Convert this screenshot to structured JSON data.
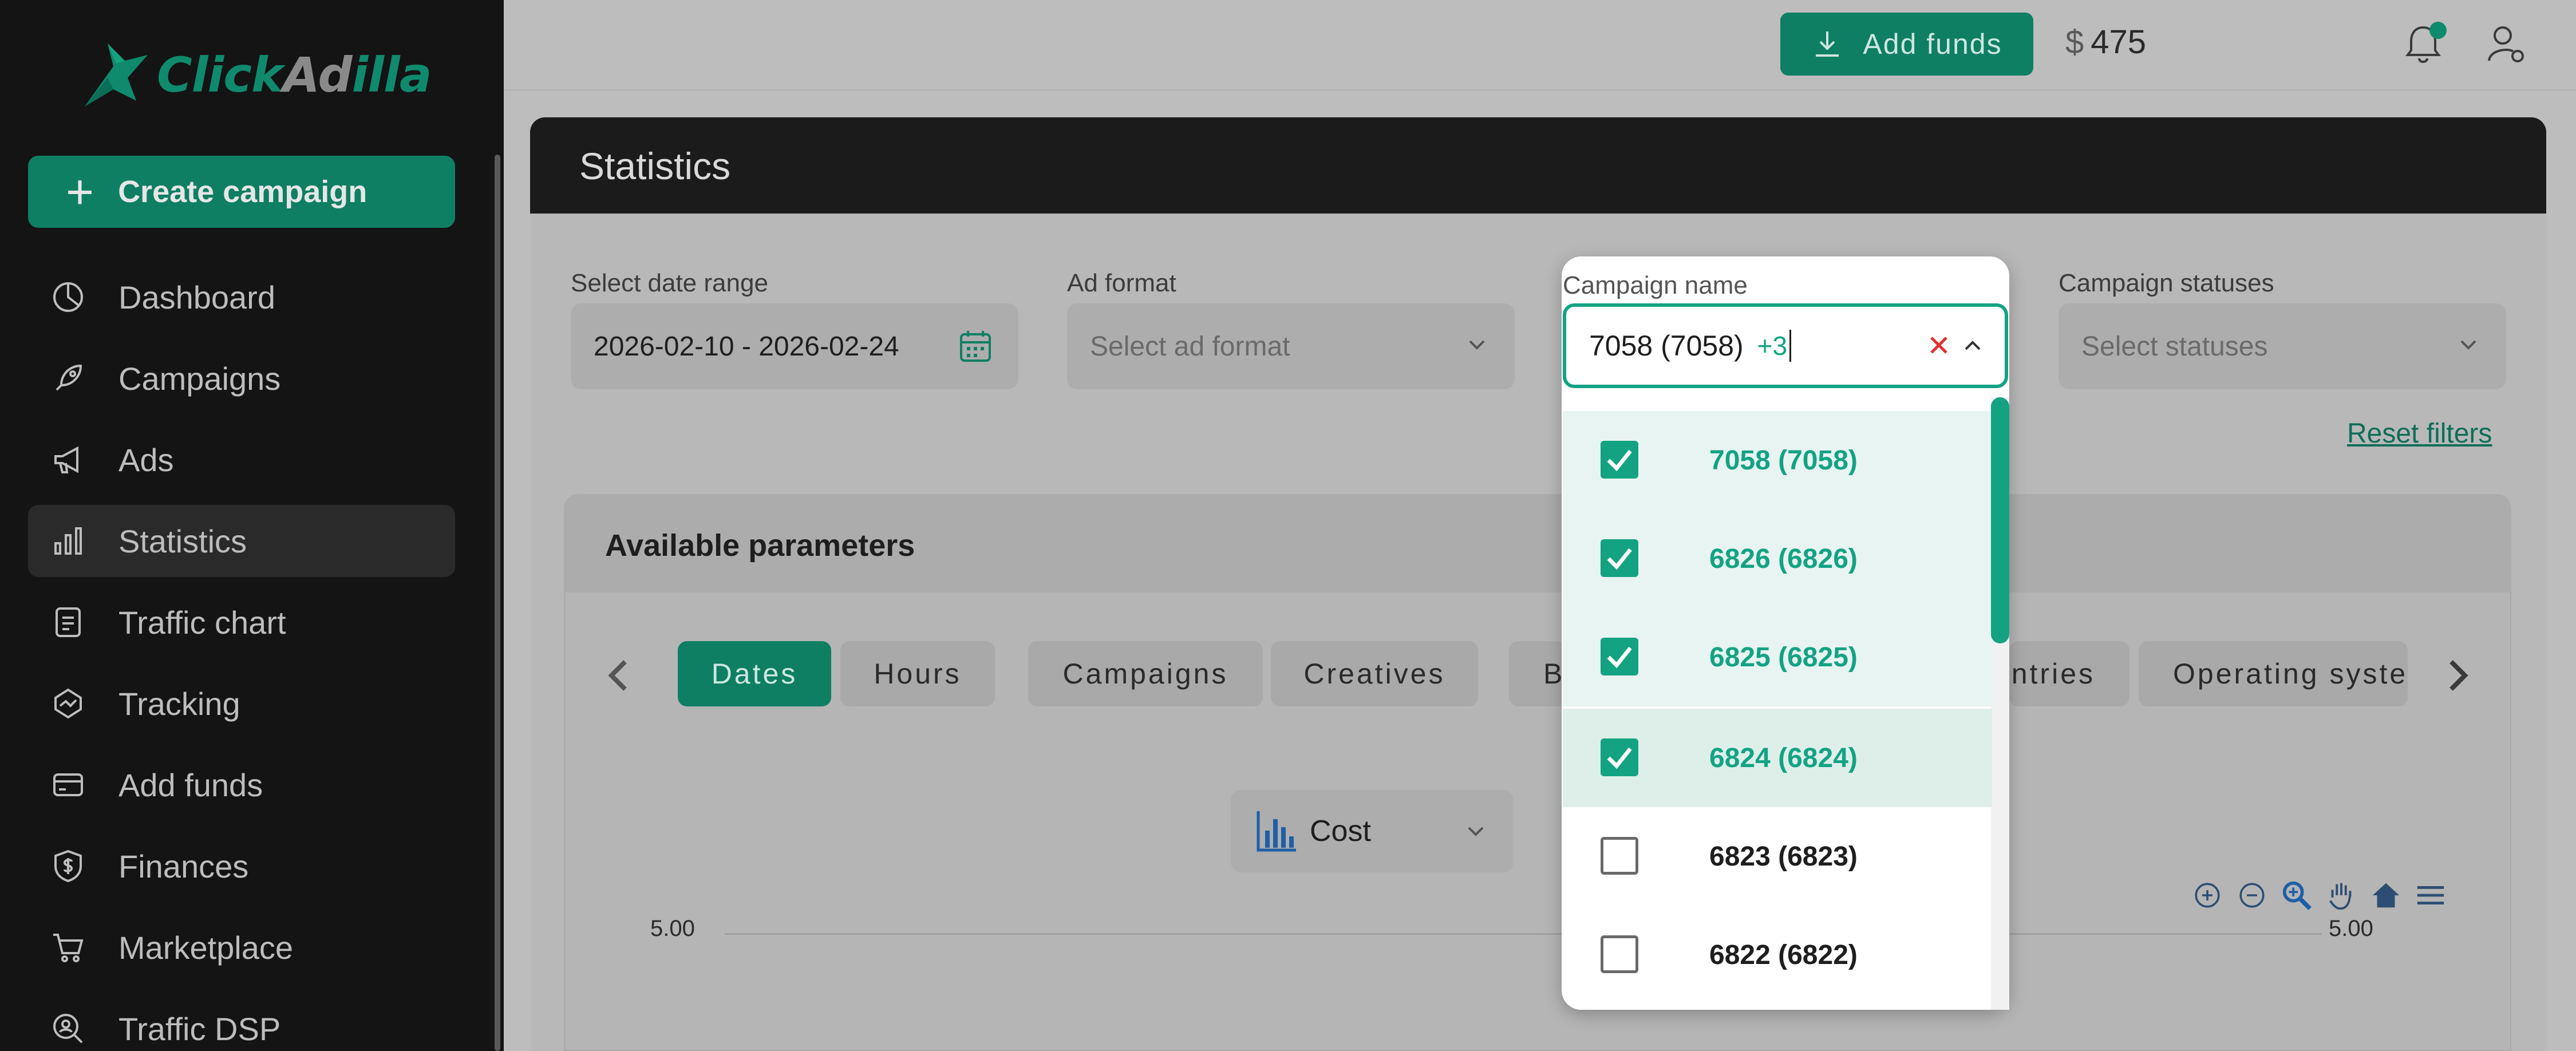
{
  "brand": {
    "name_part1": "Click",
    "name_part2": "Ad",
    "name_part3": "illa"
  },
  "sidebar": {
    "create_label": "Create campaign",
    "items": [
      {
        "label": "Dashboard",
        "icon": "dashboard-icon"
      },
      {
        "label": "Campaigns",
        "icon": "rocket-icon"
      },
      {
        "label": "Ads",
        "icon": "megaphone-icon"
      },
      {
        "label": "Statistics",
        "icon": "bar-chart-icon",
        "active": true
      },
      {
        "label": "Traffic chart",
        "icon": "document-icon"
      },
      {
        "label": "Tracking",
        "icon": "tracking-icon"
      },
      {
        "label": "Add funds",
        "icon": "credit-card-icon"
      },
      {
        "label": "Finances",
        "icon": "shield-dollar-icon"
      },
      {
        "label": "Marketplace",
        "icon": "cart-icon"
      },
      {
        "label": "Traffic DSP",
        "icon": "search-user-icon"
      }
    ]
  },
  "topbar": {
    "add_funds_label": "Add funds",
    "currency": "$",
    "balance": "475"
  },
  "page": {
    "title": "Statistics"
  },
  "filters": {
    "date_label": "Select date range",
    "date_value": "2026-02-10 - 2026-02-24",
    "format_label": "Ad format",
    "format_placeholder": "Select ad format",
    "campaign_label": "Campaign name",
    "campaign_value": "7058 (7058)",
    "campaign_more": "+3",
    "status_label": "Campaign statuses",
    "status_placeholder": "Select statuses",
    "reset_label": "Reset filters"
  },
  "campaign_options": [
    {
      "label": "7058 (7058)",
      "checked": true
    },
    {
      "label": "6826 (6826)",
      "checked": true
    },
    {
      "label": "6825 (6825)",
      "checked": true
    },
    {
      "label": "6824 (6824)",
      "checked": true
    },
    {
      "label": "6823 (6823)",
      "checked": false
    },
    {
      "label": "6822 (6822)",
      "checked": false
    }
  ],
  "params": {
    "title": "Available parameters",
    "tabs": [
      "Dates",
      "Hours",
      "Campaigns",
      "Creatives",
      "B",
      "ntries",
      "Operating syste"
    ]
  },
  "chart": {
    "metric": "Cost",
    "tick_left": "5.00",
    "tick_right": "5.00"
  },
  "colors": {
    "accent": "#13a383",
    "brand": "#0e7f63"
  }
}
